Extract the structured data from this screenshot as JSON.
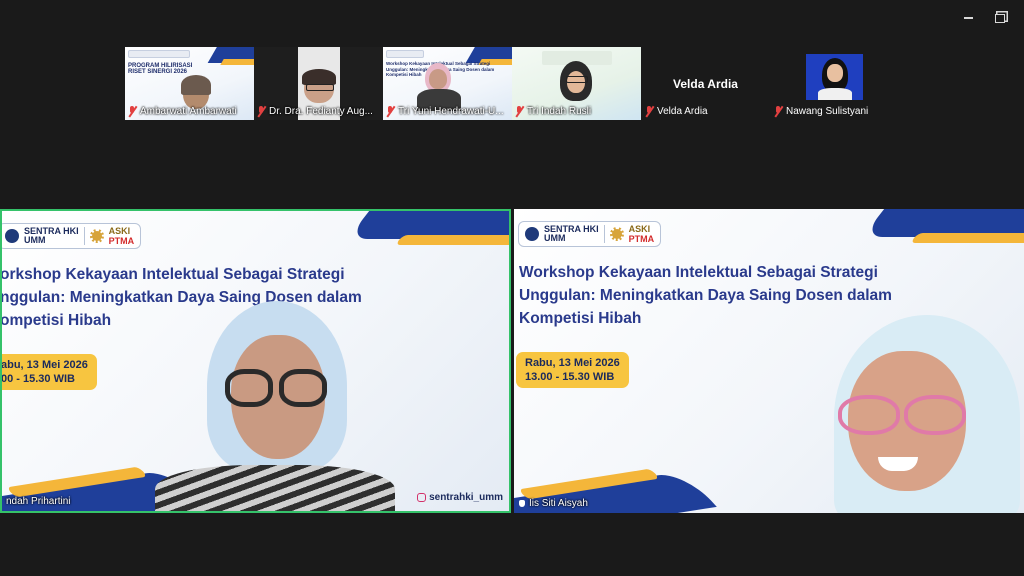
{
  "strip": {
    "tiles": [
      {
        "name": "Ambarwati Ambarwati",
        "slide_title": "PROGRAM HILIRISASI RISET SINERGI 2026"
      },
      {
        "name": "Dr. Dra. Fedianty Aug..."
      },
      {
        "name": "Tri Yuni Hendrawati-U...",
        "slide_title": "Workshop Kekayaan Intelektual Sebagai Strategi Unggulan: Meningkatkan Daya Saing Dosen dalam Kompetisi Hibah"
      },
      {
        "name": "Tri Indah Rusli"
      },
      {
        "name": "Velda Ardia",
        "display": "Velda Ardia"
      },
      {
        "name": "Nawang Sulistyani"
      }
    ]
  },
  "slide": {
    "logo_text_1": "SENTRA HKI",
    "logo_text_1b": "UMM",
    "logo_text_2": "ASKI",
    "logo_text_2b": "PTMA",
    "headline_left": "orkshop Kekayaan Intelektual Sebagai Strategi nggulan: Meningkatkan Daya Saing Dosen dalam ompetisi Hibah",
    "headline_right_lines": [
      "Workshop Kekayaan Intelektual Sebagai Strategi",
      "Unggulan: Meningkatkan Daya Saing Dosen dalam",
      "Kompetisi Hibah"
    ],
    "headline_left_lines": [
      "orkshop Kekayaan Intelektual Sebagai Strategi",
      "nggulan: Meningkatkan Daya Saing Dosen dalam",
      "ompetisi Hibah"
    ],
    "date_left": "abu, 13 Mei 2026",
    "time_left": "00 - 15.30 WIB",
    "date_right": "Rabu, 13 Mei 2026",
    "time_right": "13.00 - 15.30 WIB",
    "social": "sentrahki_umm"
  },
  "main": {
    "left_name": "ndah Prihartini",
    "right_name": "Iis Siti Aisyah"
  },
  "colors": {
    "active_speaker": "#35c26a",
    "brand_blue": "#1f3f9a",
    "brand_yellow": "#f4b63a",
    "muted": "#e24040"
  }
}
